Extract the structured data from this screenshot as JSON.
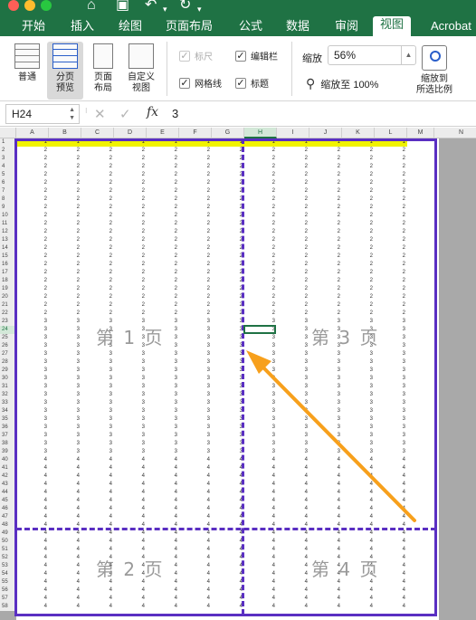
{
  "ribbon_tabs": [
    "开始",
    "插入",
    "绘图",
    "页面布局",
    "公式",
    "数据",
    "审阅",
    "视图",
    "Acrobat"
  ],
  "active_tab": "视图",
  "views": {
    "normal": "普通",
    "page_break": [
      "分页",
      "预览"
    ],
    "page_layout": [
      "页面",
      "布局"
    ],
    "custom": [
      "自定义",
      "视图"
    ]
  },
  "show": {
    "ruler": {
      "label": "标尺",
      "checked": true,
      "disabled": true
    },
    "gridlines": {
      "label": "网格线",
      "checked": true,
      "disabled": false
    },
    "formula_bar": {
      "label": "编辑栏",
      "checked": true,
      "disabled": false
    },
    "headings": {
      "label": "标题",
      "checked": true,
      "disabled": false
    }
  },
  "zoom": {
    "label": "缩放",
    "value": "56%",
    "to_100": "缩放至 100%",
    "to_selection": [
      "缩放到",
      "所选比例"
    ]
  },
  "formula_bar": {
    "name_box": "H24",
    "fx": "fx",
    "value": "3"
  },
  "sheet": {
    "columns": [
      "A",
      "B",
      "C",
      "D",
      "E",
      "F",
      "G",
      "H",
      "I",
      "J",
      "K",
      "L",
      "M",
      "N"
    ],
    "selected_column": "H",
    "selected_row": 24,
    "row_count": 58,
    "data_column_count": 12,
    "row_values": {
      "1": "1",
      "2-22": "2",
      "23-39": "3",
      "40-58": "4"
    },
    "page_watermarks": [
      "第 1 页",
      "第 2 页",
      "第 3 页",
      "第 4 页"
    ]
  },
  "colors": {
    "accent": "#1f7244",
    "page_break": "#5a2fc2",
    "arrow": "#f7a01c",
    "highlight": "#f1f300"
  }
}
